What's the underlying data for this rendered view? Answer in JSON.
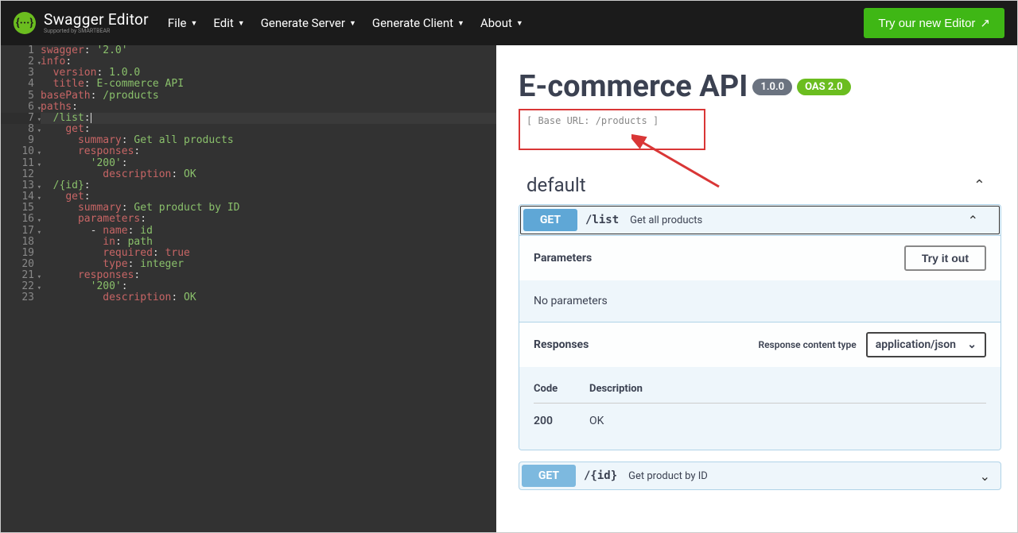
{
  "topbar": {
    "logo_braces": "{···}",
    "logo_title": "Swagger Editor",
    "logo_sub": "Supported by SMARTBEAR",
    "menu": [
      "File",
      "Edit",
      "Generate Server",
      "Generate Client",
      "About"
    ],
    "try_btn": "Try our new Editor"
  },
  "editor": {
    "lines": [
      {
        "n": 1,
        "fold": false,
        "seg": [
          [
            "key",
            "swagger"
          ],
          [
            "punc",
            ": "
          ],
          [
            "str",
            "'2.0'"
          ]
        ]
      },
      {
        "n": 2,
        "fold": true,
        "seg": [
          [
            "key",
            "info"
          ],
          [
            "punc",
            ":"
          ]
        ]
      },
      {
        "n": 3,
        "fold": false,
        "seg": [
          [
            "punc",
            "  "
          ],
          [
            "key",
            "version"
          ],
          [
            "punc",
            ": "
          ],
          [
            "str",
            "1.0.0"
          ]
        ]
      },
      {
        "n": 4,
        "fold": false,
        "seg": [
          [
            "punc",
            "  "
          ],
          [
            "key",
            "title"
          ],
          [
            "punc",
            ": "
          ],
          [
            "str",
            "E-commerce API"
          ]
        ]
      },
      {
        "n": 5,
        "fold": false,
        "seg": [
          [
            "key",
            "basePath"
          ],
          [
            "punc",
            ": "
          ],
          [
            "str",
            "/products"
          ]
        ]
      },
      {
        "n": 6,
        "fold": true,
        "seg": [
          [
            "key",
            "paths"
          ],
          [
            "punc",
            ":"
          ]
        ]
      },
      {
        "n": 7,
        "fold": true,
        "hl": true,
        "seg": [
          [
            "punc",
            "  "
          ],
          [
            "str",
            "/list"
          ],
          [
            "punc",
            ":"
          ]
        ],
        "cursor": true
      },
      {
        "n": 8,
        "fold": true,
        "seg": [
          [
            "punc",
            "    "
          ],
          [
            "key",
            "get"
          ],
          [
            "punc",
            ":"
          ]
        ]
      },
      {
        "n": 9,
        "fold": false,
        "seg": [
          [
            "punc",
            "      "
          ],
          [
            "key",
            "summary"
          ],
          [
            "punc",
            ": "
          ],
          [
            "str",
            "Get all products"
          ]
        ]
      },
      {
        "n": 10,
        "fold": true,
        "seg": [
          [
            "punc",
            "      "
          ],
          [
            "key",
            "responses"
          ],
          [
            "punc",
            ":"
          ]
        ]
      },
      {
        "n": 11,
        "fold": true,
        "seg": [
          [
            "punc",
            "        "
          ],
          [
            "str",
            "'200'"
          ],
          [
            "punc",
            ":"
          ]
        ]
      },
      {
        "n": 12,
        "fold": false,
        "seg": [
          [
            "punc",
            "          "
          ],
          [
            "key",
            "description"
          ],
          [
            "punc",
            ": "
          ],
          [
            "str",
            "OK"
          ]
        ]
      },
      {
        "n": 13,
        "fold": true,
        "seg": [
          [
            "punc",
            "  "
          ],
          [
            "str",
            "/{id}"
          ],
          [
            "punc",
            ":"
          ]
        ]
      },
      {
        "n": 14,
        "fold": true,
        "seg": [
          [
            "punc",
            "    "
          ],
          [
            "key",
            "get"
          ],
          [
            "punc",
            ":"
          ]
        ]
      },
      {
        "n": 15,
        "fold": false,
        "seg": [
          [
            "punc",
            "      "
          ],
          [
            "key",
            "summary"
          ],
          [
            "punc",
            ": "
          ],
          [
            "str",
            "Get product by ID"
          ]
        ]
      },
      {
        "n": 16,
        "fold": true,
        "seg": [
          [
            "punc",
            "      "
          ],
          [
            "key",
            "parameters"
          ],
          [
            "punc",
            ":"
          ]
        ]
      },
      {
        "n": 17,
        "fold": true,
        "seg": [
          [
            "punc",
            "        - "
          ],
          [
            "key",
            "name"
          ],
          [
            "punc",
            ": "
          ],
          [
            "str",
            "id"
          ]
        ]
      },
      {
        "n": 18,
        "fold": false,
        "seg": [
          [
            "punc",
            "          "
          ],
          [
            "key",
            "in"
          ],
          [
            "punc",
            ": "
          ],
          [
            "str",
            "path"
          ]
        ]
      },
      {
        "n": 19,
        "fold": false,
        "seg": [
          [
            "punc",
            "          "
          ],
          [
            "key",
            "required"
          ],
          [
            "punc",
            ": "
          ],
          [
            "bool",
            "true"
          ]
        ]
      },
      {
        "n": 20,
        "fold": false,
        "seg": [
          [
            "punc",
            "          "
          ],
          [
            "key",
            "type"
          ],
          [
            "punc",
            ": "
          ],
          [
            "str",
            "integer"
          ]
        ]
      },
      {
        "n": 21,
        "fold": true,
        "seg": [
          [
            "punc",
            "      "
          ],
          [
            "key",
            "responses"
          ],
          [
            "punc",
            ":"
          ]
        ]
      },
      {
        "n": 22,
        "fold": true,
        "seg": [
          [
            "punc",
            "        "
          ],
          [
            "str",
            "'200'"
          ],
          [
            "punc",
            ":"
          ]
        ]
      },
      {
        "n": 23,
        "fold": false,
        "seg": [
          [
            "punc",
            "          "
          ],
          [
            "key",
            "description"
          ],
          [
            "punc",
            ": "
          ],
          [
            "str",
            "OK"
          ]
        ]
      }
    ]
  },
  "api": {
    "title": "E-commerce API",
    "version": "1.0.0",
    "oas": "OAS 2.0",
    "base_url": "[ Base URL: /products ]",
    "section": "default",
    "ops": [
      {
        "method": "GET",
        "path": "/list",
        "summary": "Get all products",
        "expanded": true,
        "params_title": "Parameters",
        "tryout": "Try it out",
        "no_params": "No parameters",
        "resp_title": "Responses",
        "ct_label": "Response content type",
        "ct_value": "application/json",
        "resp_cols": [
          "Code",
          "Description"
        ],
        "resp_rows": [
          {
            "code": "200",
            "desc": "OK"
          }
        ]
      },
      {
        "method": "GET",
        "path": "/{id}",
        "summary": "Get product by ID",
        "expanded": false
      }
    ]
  }
}
